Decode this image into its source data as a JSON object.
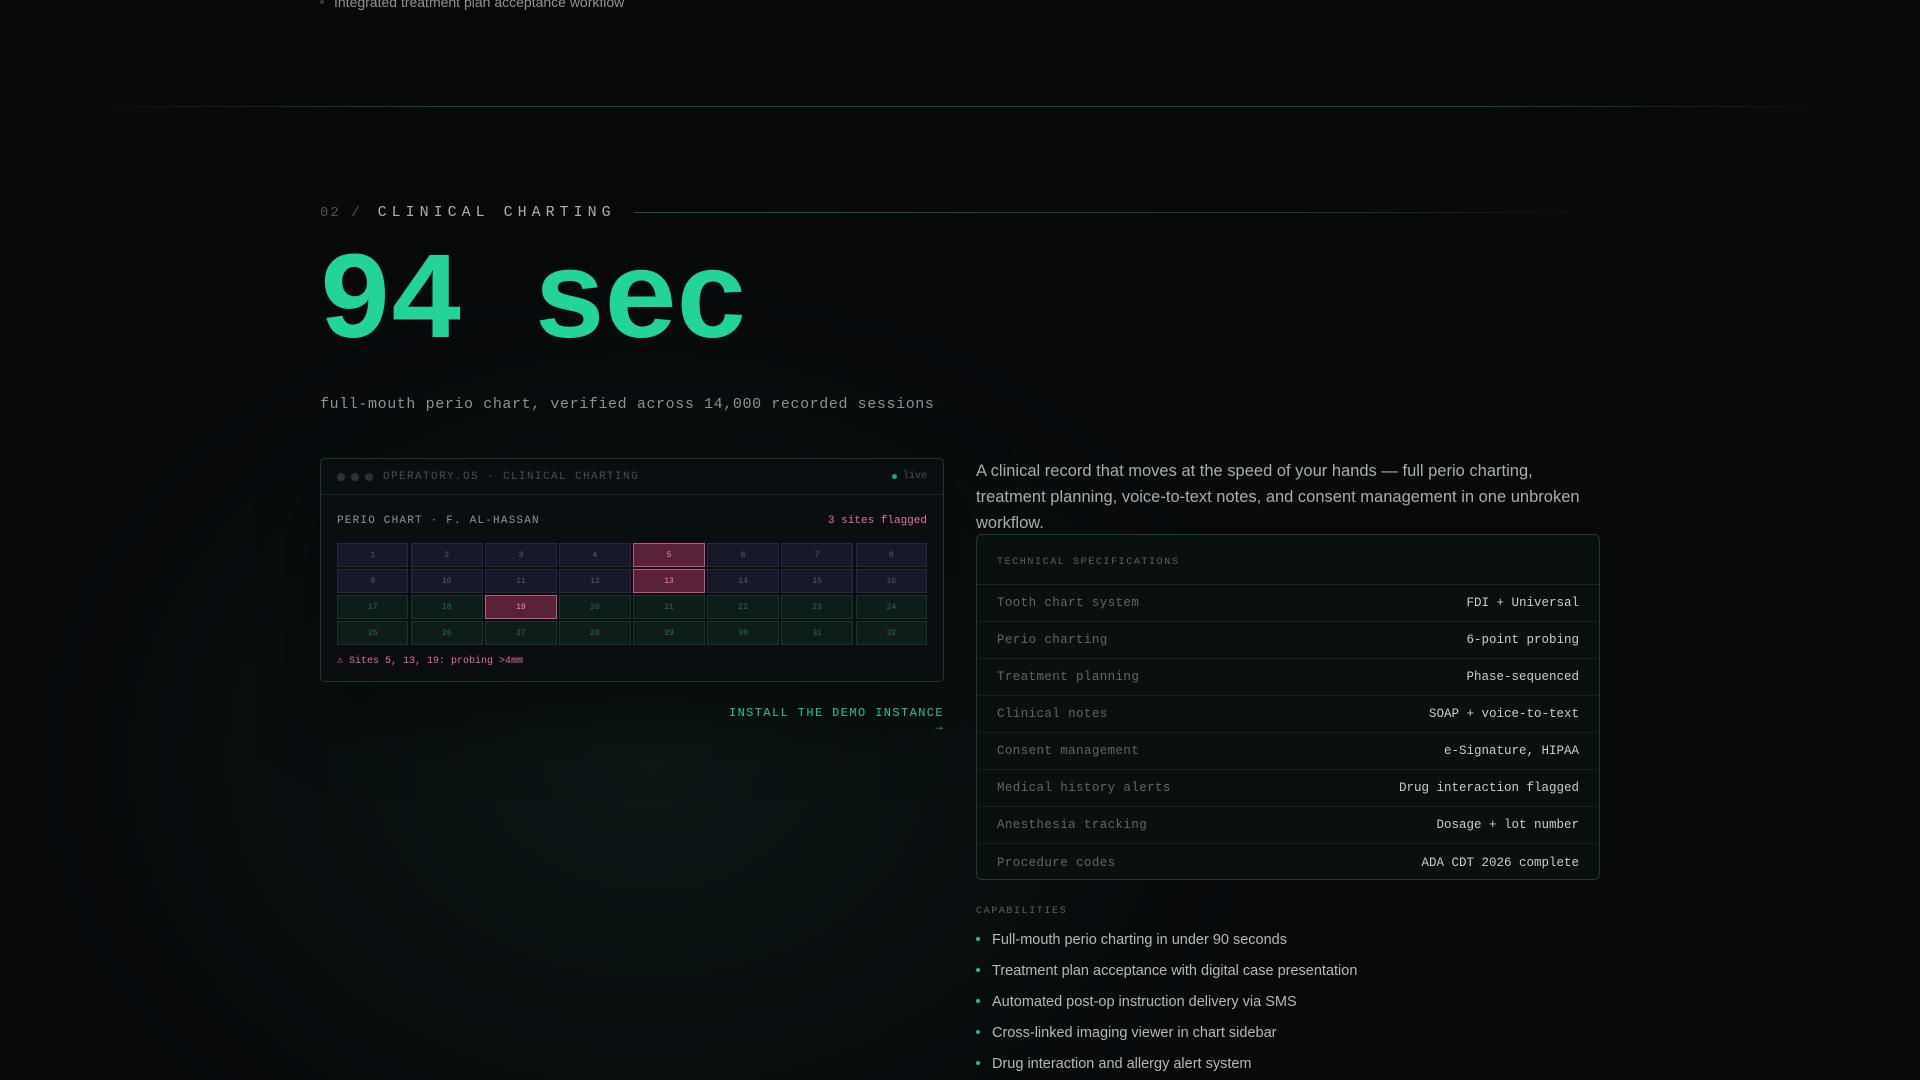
{
  "previous_section": {
    "tail_text": "Integrated treatment plan acceptance workflow"
  },
  "section": {
    "number": "02 /",
    "label": "CLINICAL CHARTING",
    "hero_stat": "94 sec",
    "hero_subtitle": "full-mouth perio chart, verified across 14,000 recorded sessions"
  },
  "app_window": {
    "title": "OPERATORY.OS · CLINICAL CHARTING",
    "status": "live",
    "chart_title": "PERIO CHART · F. AL-HASSAN",
    "flag_summary": "3 sites flagged",
    "teeth": [
      "1",
      "2",
      "3",
      "4",
      "5",
      "6",
      "7",
      "8",
      "9",
      "10",
      "11",
      "12",
      "13",
      "14",
      "15",
      "16",
      "17",
      "18",
      "19",
      "20",
      "21",
      "22",
      "23",
      "24",
      "25",
      "26",
      "27",
      "28",
      "29",
      "30",
      "31",
      "32"
    ],
    "flagged_teeth": [
      "5",
      "13",
      "19"
    ],
    "alert_text": "⚠ Sites 5, 13, 19: probing >4mm"
  },
  "demo_link": "INSTALL THE DEMO INSTANCE →",
  "intro": "A clinical record that moves at the speed of your hands — full perio charting, treatment planning, voice-to-text notes, and consent management in one unbroken workflow.",
  "specs": {
    "heading": "TECHNICAL SPECIFICATIONS",
    "rows": [
      {
        "label": "Tooth chart system",
        "value": "FDI + Universal"
      },
      {
        "label": "Perio charting",
        "value": "6-point probing"
      },
      {
        "label": "Treatment planning",
        "value": "Phase-sequenced"
      },
      {
        "label": "Clinical notes",
        "value": "SOAP + voice-to-text"
      },
      {
        "label": "Consent management",
        "value": "e-Signature, HIPAA"
      },
      {
        "label": "Medical history alerts",
        "value": "Drug interaction flagged"
      },
      {
        "label": "Anesthesia tracking",
        "value": "Dosage + lot number"
      },
      {
        "label": "Procedure codes",
        "value": "ADA CDT 2026 complete"
      }
    ]
  },
  "capabilities": {
    "heading": "CAPABILITIES",
    "items": [
      "Full-mouth perio charting in under 90 seconds",
      "Treatment plan acceptance with digital case presentation",
      "Automated post-op instruction delivery via SMS",
      "Cross-linked imaging viewer in chart sidebar",
      "Drug interaction and allergy alert system"
    ]
  },
  "colors": {
    "accent": "#22d39a",
    "flag": "#e86ea2",
    "background": "#07090b"
  }
}
